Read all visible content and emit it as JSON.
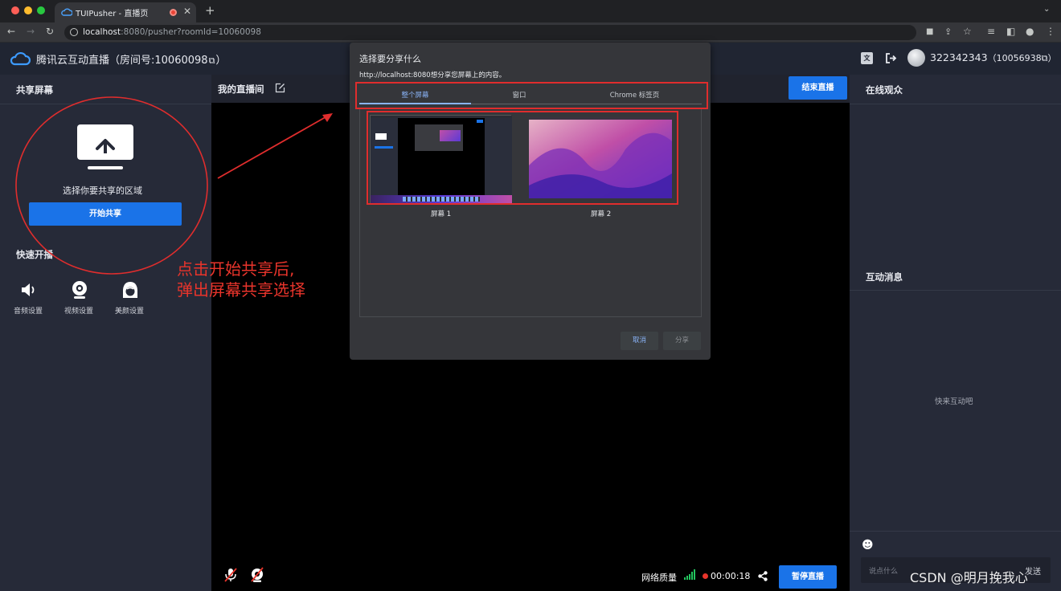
{
  "browser": {
    "tab_title": "TUIPusher - 直播页",
    "url_host": "localhost",
    "url_rest": ":8080/pusher?roomId=10060098"
  },
  "header": {
    "title": "腾讯云互动直播（房间号:10060098",
    "title_end": "）",
    "user_id": "322342343",
    "user_room": "（10056938",
    "user_room_end": "）"
  },
  "left_panel": {
    "share_title": "共享屏幕",
    "share_prompt": "选择你要共享的区域",
    "start_share_label": "开始共享",
    "quick_title": "快速开播",
    "tools": [
      {
        "label": "音频设置",
        "icon": "speaker-icon"
      },
      {
        "label": "视频设置",
        "icon": "webcam-icon"
      },
      {
        "label": "美颜设置",
        "icon": "beauty-icon"
      }
    ]
  },
  "center": {
    "room_title": "我的直播间",
    "end_live_label": "结束直播",
    "network_label": "网络质量",
    "timer": "00:00:18",
    "pause_label": "暂停直播"
  },
  "right_panel": {
    "audience_title": "在线观众",
    "messages_title": "互动消息",
    "empty_text": "快来互动吧",
    "input_placeholder": "说点什么",
    "send_label": "发送"
  },
  "dialog": {
    "title": "选择要分享什么",
    "subtitle": "http://localhost:8080想分享您屏幕上的内容。",
    "tabs": [
      "整个屏幕",
      "窗口",
      "Chrome 标签页"
    ],
    "screens": [
      "屏幕 1",
      "屏幕 2"
    ],
    "cancel_label": "取消",
    "share_label": "分享"
  },
  "annotation": {
    "line1": "点击开始共享后,",
    "line2": "弹出屏幕共享选择"
  },
  "watermark": "CSDN @明月挽我心",
  "colors": {
    "accent": "#1a73e8",
    "annotation_red": "#e02d2d",
    "panel_bg": "#262a38",
    "dialog_bg": "#35363a"
  }
}
